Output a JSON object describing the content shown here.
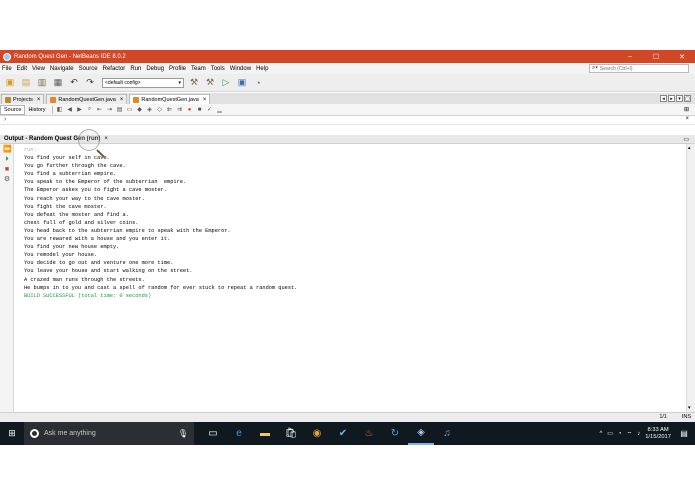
{
  "window": {
    "title": "Random Quest Gen - NetBeans IDE 8.0.2",
    "controls": [
      "–",
      "☐",
      "✕"
    ]
  },
  "menu": {
    "items": [
      "File",
      "Edit",
      "View",
      "Navigate",
      "Source",
      "Refactor",
      "Run",
      "Debug",
      "Profile",
      "Team",
      "Tools",
      "Window",
      "Help"
    ],
    "search_placeholder": "Search (Ctrl+I)"
  },
  "toolbar": {
    "config_value": "<default config>"
  },
  "tabs": [
    {
      "label": "Projects",
      "active": false
    },
    {
      "label": "RandomQuestGen.java",
      "active": false
    },
    {
      "label": "RandomQuestGen.java",
      "active": true
    }
  ],
  "editor": {
    "source_label": "Source",
    "history_label": "History"
  },
  "output": {
    "title": "Output - Random Quest Gen (run)",
    "run_label": "run:",
    "lines": [
      "You find your self in cave.",
      "You go further through the cave.",
      "You find a subterrian empire.",
      "You speak to the Emperor of the subterrian  empire.",
      "The Emperor askes you to fight a cave moster.",
      "You reach your way to the cave moster.",
      "You fight the cave moster.",
      "You defeat the moster and find a.",
      "chest full of gold and silver coins.",
      "You head back to the subterrian empire to speak with the Emperor.",
      "You are rewared with a house and you enter it.",
      "You find your new house empty.",
      "You remodel your house.",
      "You decide to go out and venture one more time.",
      "You leave your house and start walking on the street.",
      "A crazed man runs through the streets.",
      "He bumps in to you and cast a spell of random for ever stuck to repeat a random quest."
    ],
    "build_result": "BUILD SUCCESSFUL (total time: 0 seconds)"
  },
  "status": {
    "position": "1/1",
    "mode": "INS"
  },
  "taskbar": {
    "search_placeholder": "Ask me anything",
    "time": "8:33 AM",
    "date": "1/15/2017"
  },
  "colors": {
    "titlebar": "#d24726",
    "build_success": "#1b9b3b",
    "taskbar": "#101820"
  }
}
